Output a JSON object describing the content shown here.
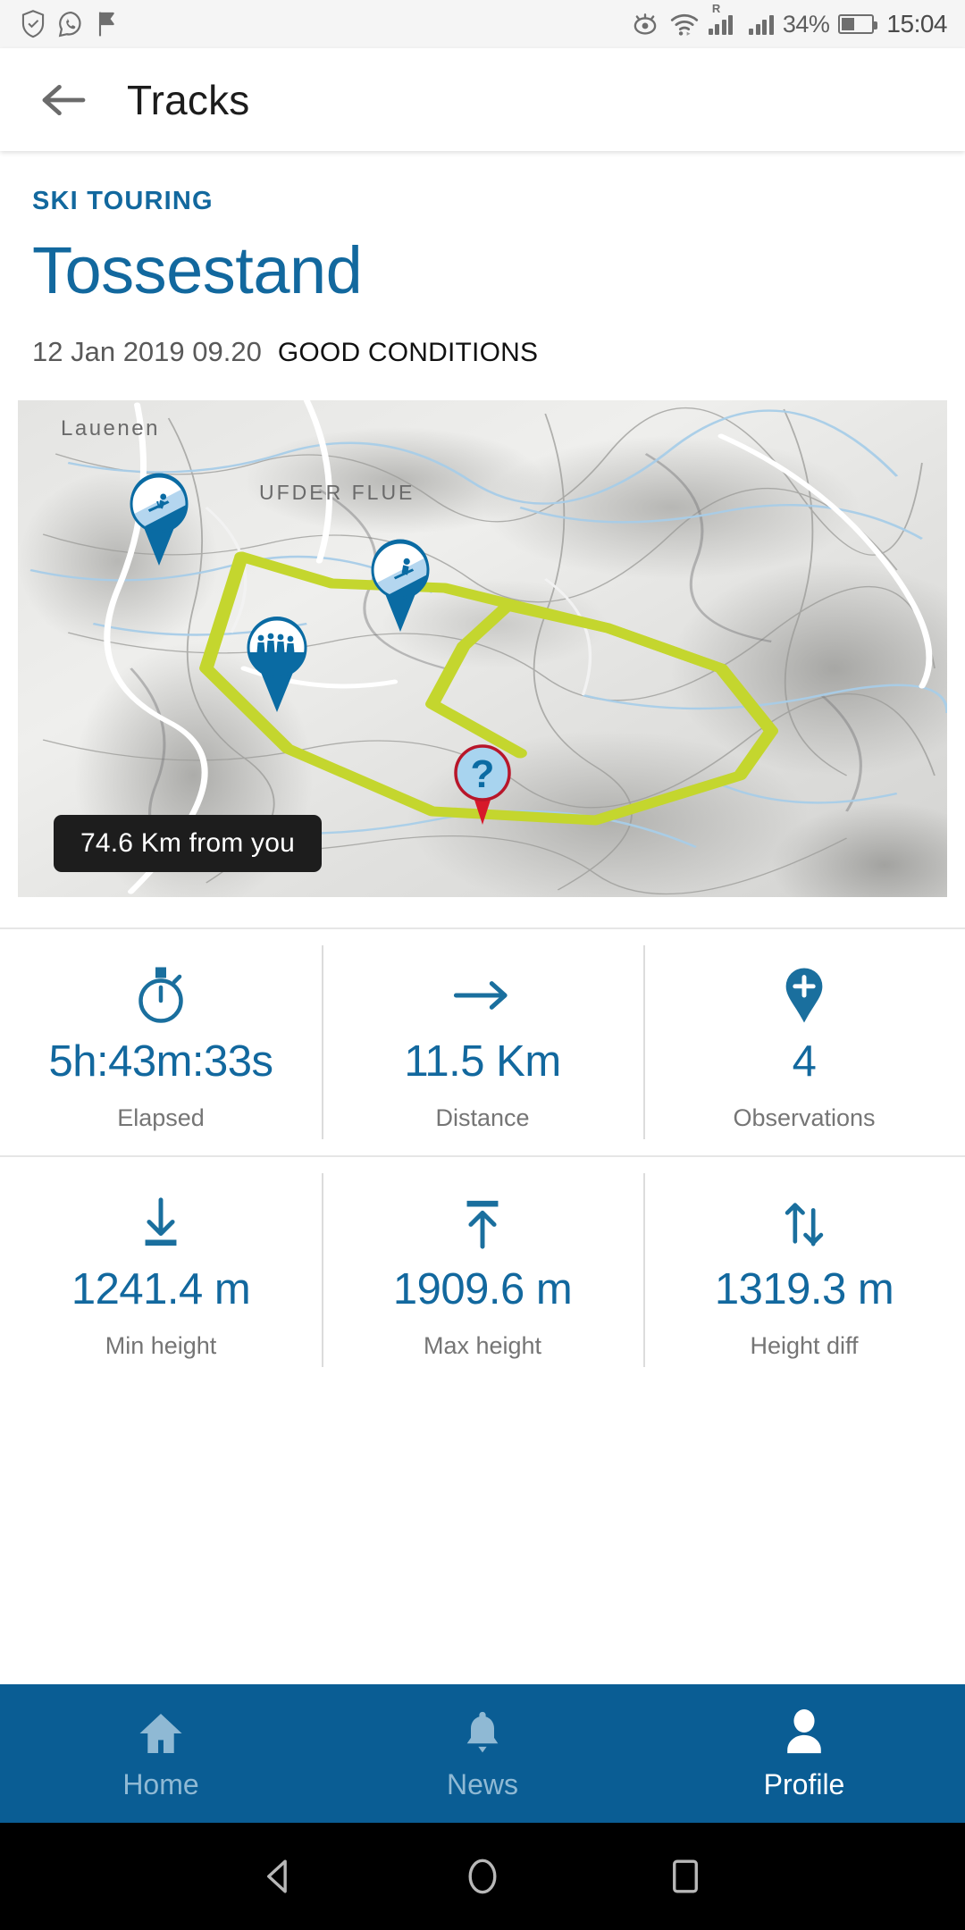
{
  "status_bar": {
    "left_icons": [
      "shield-check-icon",
      "whatsapp-icon",
      "flag-icon"
    ],
    "right_icons": [
      "eye-comfort-icon",
      "wifi-icon",
      "roaming-signal-icon",
      "signal-icon"
    ],
    "battery_percent": "34%",
    "time": "15:04",
    "roaming_letter": "R"
  },
  "app_bar": {
    "back_label": "back-arrow",
    "title": "Tracks"
  },
  "track": {
    "category": "SKI TOURING",
    "title": "Tossestand",
    "date": "12 Jan 2019 09.20",
    "conditions": "GOOD CONDITIONS"
  },
  "map": {
    "distance_badge": "74.6 Km from you",
    "labels": [
      {
        "text": "Lauenen"
      },
      {
        "text": "UFDER FLUE"
      }
    ],
    "markers": [
      {
        "name": "ski-touring-marker-1",
        "icon": "skier-uphill-icon"
      },
      {
        "name": "ski-touring-marker-2",
        "icon": "skier-downhill-icon"
      },
      {
        "name": "group-marker",
        "icon": "people-group-icon"
      },
      {
        "name": "question-marker",
        "icon": "question-mark-icon"
      }
    ],
    "track_color": "#c4d62e",
    "marker_color": "#0a6ba3",
    "question_marker_color": "#c8102e"
  },
  "stats": {
    "rows": [
      [
        {
          "icon": "stopwatch-icon",
          "value": "5h:43m:33s",
          "label": "Elapsed"
        },
        {
          "icon": "arrow-right-icon",
          "value": "11.5 Km",
          "label": "Distance"
        },
        {
          "icon": "map-pin-plus-icon",
          "value": "4",
          "label": "Observations"
        }
      ],
      [
        {
          "icon": "arrow-down-to-line-icon",
          "value": "1241.4 m",
          "label": "Min height"
        },
        {
          "icon": "arrow-up-to-line-icon",
          "value": "1909.6 m",
          "label": "Max height"
        },
        {
          "icon": "arrows-up-down-icon",
          "value": "1319.3 m",
          "label": "Height diff"
        }
      ]
    ]
  },
  "bottom_nav": {
    "items": [
      {
        "label": "Home",
        "icon": "home-icon",
        "active": false
      },
      {
        "label": "News",
        "icon": "bell-icon",
        "active": false
      },
      {
        "label": "Profile",
        "icon": "person-icon",
        "active": true
      }
    ]
  },
  "android_nav": {
    "items": [
      "back-triangle-icon",
      "home-circle-icon",
      "recents-square-icon"
    ]
  },
  "colors": {
    "brand_blue": "#0a5d94",
    "accent_blue": "#12689e",
    "track_green": "#c4d62e",
    "red": "#c8102e"
  }
}
